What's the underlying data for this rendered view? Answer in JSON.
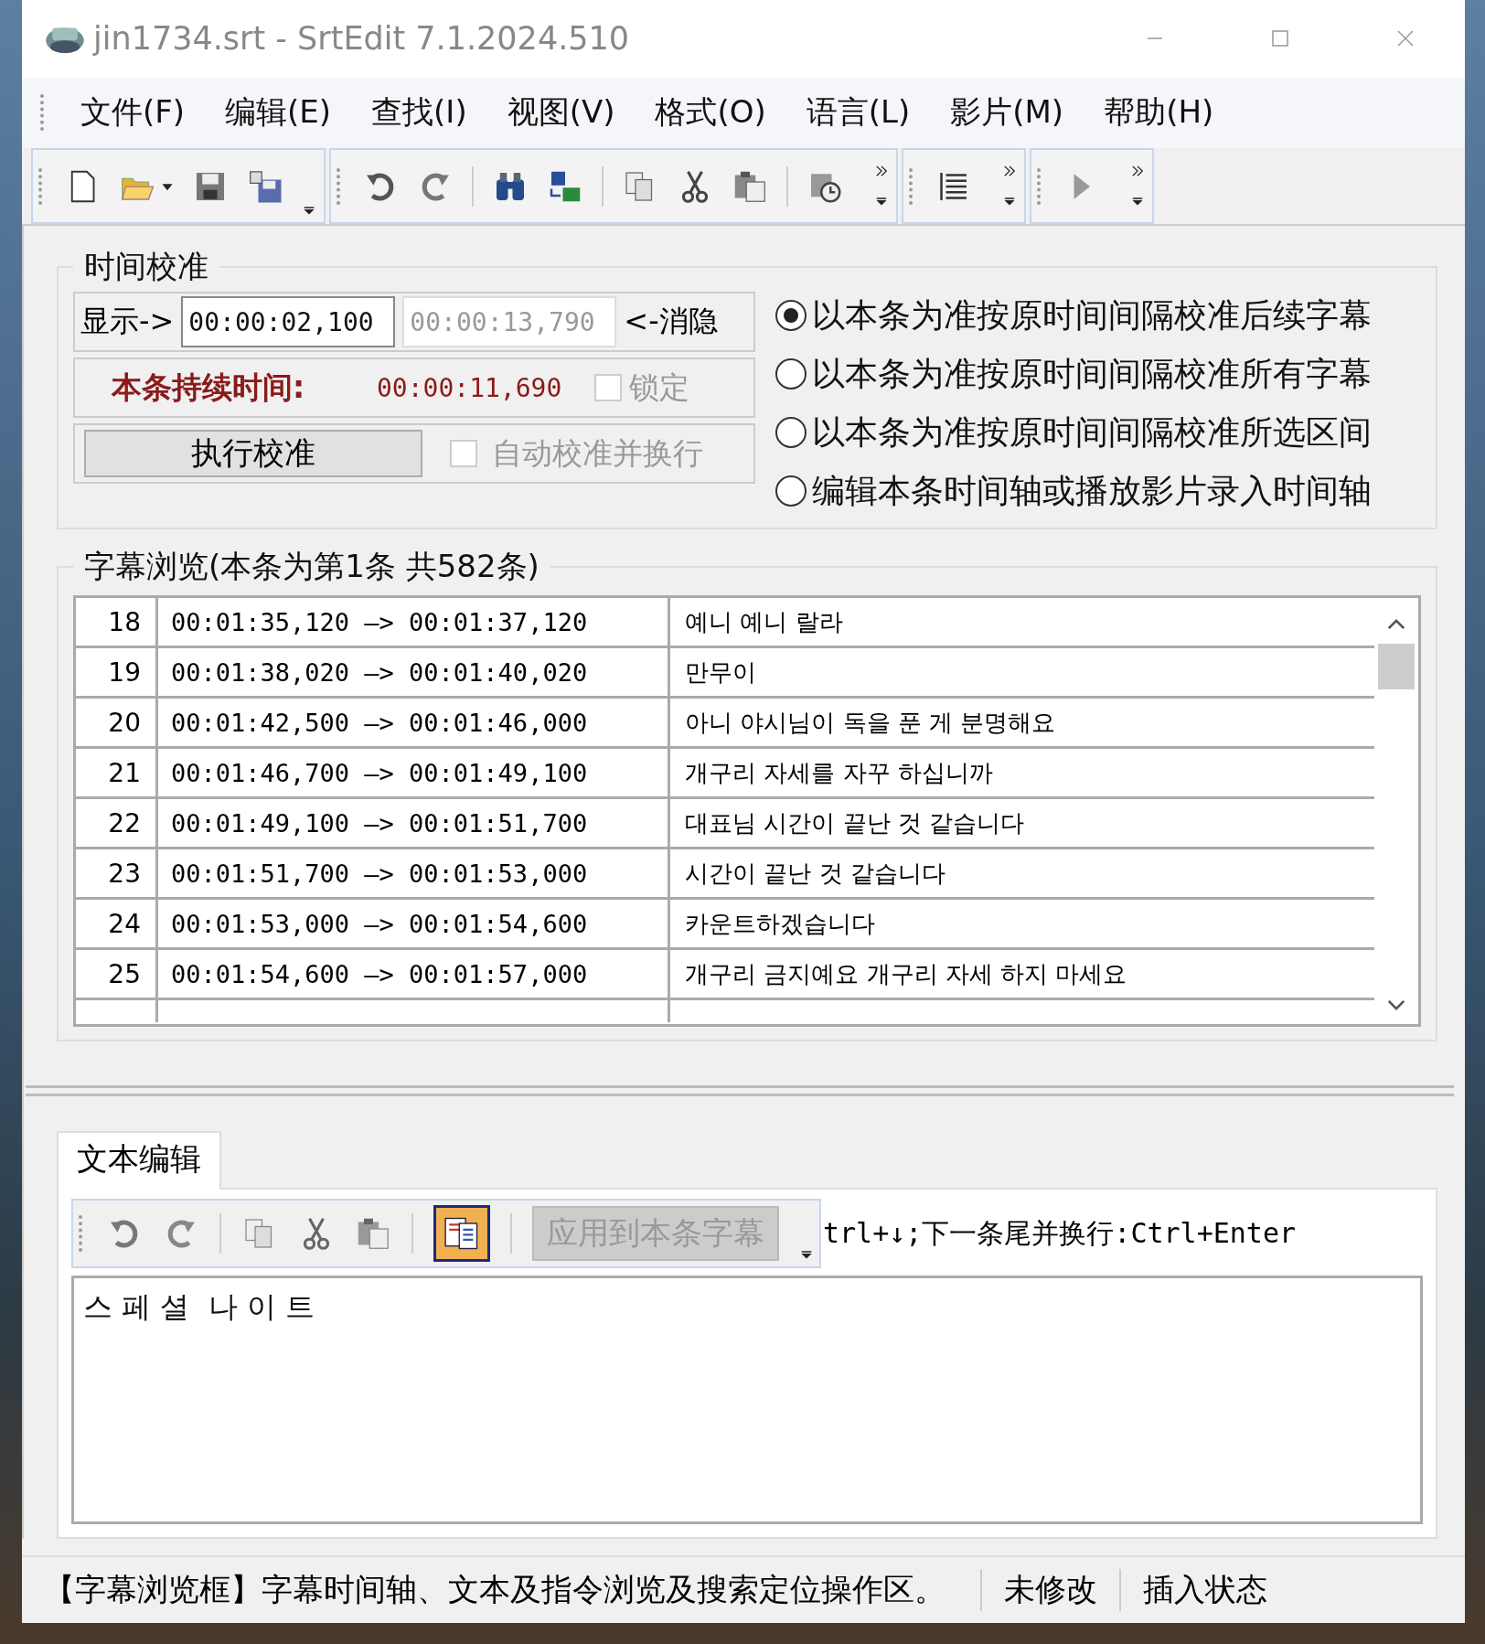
{
  "window": {
    "title": "jin1734.srt - SrtEdit 7.1.2024.510"
  },
  "menu": [
    "文件(F)",
    "编辑(E)",
    "查找(I)",
    "视图(V)",
    "格式(O)",
    "语言(L)",
    "影片(M)",
    "帮助(H)"
  ],
  "calibration": {
    "title": "时间校准",
    "show_label": "显示->",
    "start_time": "00:00:02,100",
    "end_time": "00:00:13,790",
    "hide_label": "<-消隐",
    "duration_label": "本条持续时间:",
    "duration": "00:00:11,690",
    "lock": {
      "label": "锁定",
      "checked": false,
      "disabled": true
    },
    "execute_button": "执行校准",
    "auto": {
      "label": "自动校准并换行",
      "checked": false,
      "disabled": true
    },
    "modes": [
      {
        "label": "以本条为准按原时间间隔校准后续字幕",
        "selected": true
      },
      {
        "label": "以本条为准按原时间间隔校准所有字幕",
        "selected": false
      },
      {
        "label": "以本条为准按原时间间隔校准所选区间",
        "selected": false
      },
      {
        "label": "编辑本条时间轴或播放影片录入时间轴",
        "selected": false
      }
    ]
  },
  "browser": {
    "title": "字幕浏览(本条为第1条  共582条)",
    "rows": [
      {
        "index": "18",
        "time": "00:01:35,120 —> 00:01:37,120",
        "text": "예니 예니 랄라"
      },
      {
        "index": "19",
        "time": "00:01:38,020 —> 00:01:40,020",
        "text": "만무이"
      },
      {
        "index": "20",
        "time": "00:01:42,500 —> 00:01:46,000",
        "text": "아니 야시님이 독을 푼 게 분명해요"
      },
      {
        "index": "21",
        "time": "00:01:46,700 —> 00:01:49,100",
        "text": "개구리 자세를 자꾸 하십니까"
      },
      {
        "index": "22",
        "time": "00:01:49,100 —> 00:01:51,700",
        "text": "대표님 시간이 끝난 것 같습니다"
      },
      {
        "index": "23",
        "time": "00:01:51,700 —> 00:01:53,000",
        "text": "시간이 끝난 것 같습니다"
      },
      {
        "index": "24",
        "time": "00:01:53,000 —> 00:01:54,600",
        "text": "카운트하겠습니다"
      },
      {
        "index": "25",
        "time": "00:01:54,600 —> 00:01:57,000",
        "text": "개구리 금지예요 개구리 자세 하지 마세요"
      }
    ]
  },
  "editor": {
    "tab": {
      "label": "文本编辑",
      "selected": true
    },
    "wrap_toggle": {
      "on": true
    },
    "apply_button": {
      "label": "应用到本条字幕",
      "disabled": true
    },
    "hint": "trl+↓;下一条尾并换行:Ctrl+Enter",
    "text": "스 페 셜  나 이 트"
  },
  "status_bar": [
    "【字幕浏览框】字幕时间轴、文本及指令浏览及搜索定位操作区。",
    "未修改",
    "插入状态"
  ]
}
